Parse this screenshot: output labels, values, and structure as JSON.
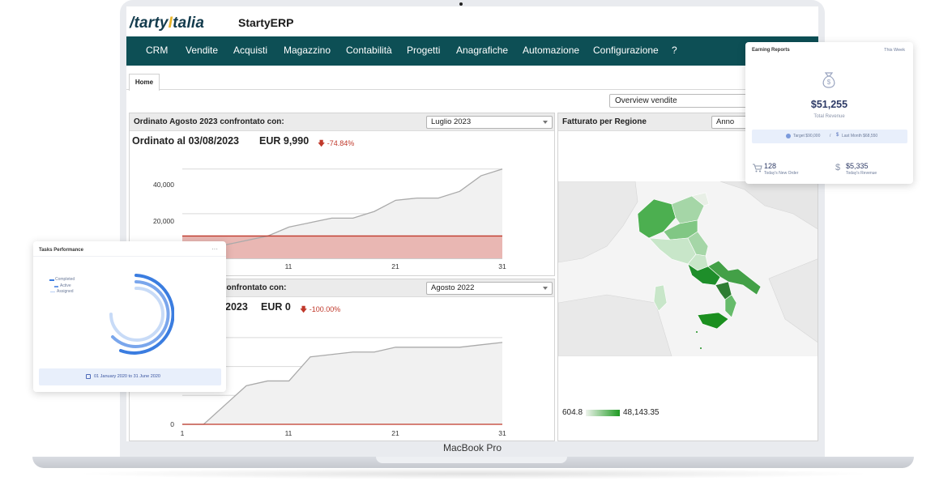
{
  "device": {
    "label": "MacBook Pro"
  },
  "header": {
    "logo_prefix": "/tarty",
    "logo_accent": "I",
    "logo_suffix": "talia",
    "app_title": "StartyERP"
  },
  "nav": [
    "CRM",
    "Vendite",
    "Acquisti",
    "Magazzino",
    "Contabilità",
    "Progetti",
    "Anagrafiche",
    "Automazione",
    "Configurazione",
    "?"
  ],
  "tabs": {
    "home": "Home"
  },
  "overview_select": "Overview vendite",
  "panel_orders": {
    "title": "Ordinato Agosto 2023 confrontato con:",
    "compare_select": "Luglio 2023",
    "headline": "Ordinato al 03/08/2023",
    "amount": "EUR 9,990",
    "delta": "-74.84%",
    "x_ticks": [
      "11",
      "21",
      "31"
    ],
    "y_ticks": [
      "40,000",
      "20,000"
    ]
  },
  "panel_orders_2": {
    "title_partial": "confrontato con:",
    "compare_select": "Agosto 2022",
    "headline_partial": "2023",
    "amount": "EUR 0",
    "delta": "-100.00%",
    "x_ticks": [
      "1",
      "11",
      "21",
      "31"
    ],
    "y_ticks": [
      "0"
    ]
  },
  "panel_region": {
    "title": "Fatturato per Regione",
    "period_select": "Anno",
    "legend_min": "604.8",
    "legend_max": "48,143.35"
  },
  "earning_card": {
    "title": "Earning Reports",
    "period": "This Week",
    "total": "$51,255",
    "total_label": "Total Revenue",
    "target": "Target $90,000",
    "separator": "/",
    "last_month": "Last Month $68,550",
    "orders_value": "128",
    "orders_label": "Today's New Order",
    "revenue_value": "$5,335",
    "revenue_label": "Today's Revenue"
  },
  "tasks_card": {
    "title": "Tasks Performance",
    "legend": [
      "Completed",
      "Active",
      "Assigned"
    ],
    "date_range": "01 January 2020 to 31 June 2020"
  },
  "chart_data": [
    {
      "type": "line",
      "title": "Ordinato Agosto 2023 confrontato con:",
      "x": [
        1,
        3,
        5,
        7,
        9,
        11,
        13,
        15,
        17,
        19,
        21,
        23,
        25,
        27,
        29,
        31
      ],
      "series": [
        {
          "values": [
            2000,
            4000,
            6000,
            8000,
            10000,
            14000,
            16000,
            18000,
            18000,
            21000,
            26000,
            27000,
            27000,
            30000,
            37000,
            40000
          ],
          "color": "#aaaaaa"
        },
        {
          "values": [
            10000,
            10000,
            10000,
            10000,
            10000,
            10000,
            10000,
            10000,
            10000,
            10000,
            10000,
            10000,
            10000,
            10000,
            10000,
            10000
          ],
          "color": "#c0392b"
        }
      ],
      "ylim": [
        0,
        45000
      ],
      "xlim": [
        1,
        31
      ]
    },
    {
      "type": "line",
      "x": [
        1,
        3,
        5,
        7,
        9,
        11,
        13,
        15,
        17,
        19,
        21,
        23,
        25,
        27,
        29,
        31
      ],
      "series": [
        {
          "values": [
            0,
            0,
            4000,
            8000,
            9000,
            9000,
            14000,
            14500,
            15000,
            15000,
            16000,
            16000,
            16000,
            16000,
            16500,
            17000
          ],
          "color": "#aaaaaa"
        },
        {
          "values": [
            0,
            0,
            0,
            0,
            0,
            0,
            0,
            0,
            0,
            0,
            0,
            0,
            0,
            0,
            0,
            0
          ],
          "color": "#c0392b"
        }
      ],
      "ylim": [
        0,
        20000
      ],
      "xlim": [
        1,
        31
      ]
    }
  ]
}
